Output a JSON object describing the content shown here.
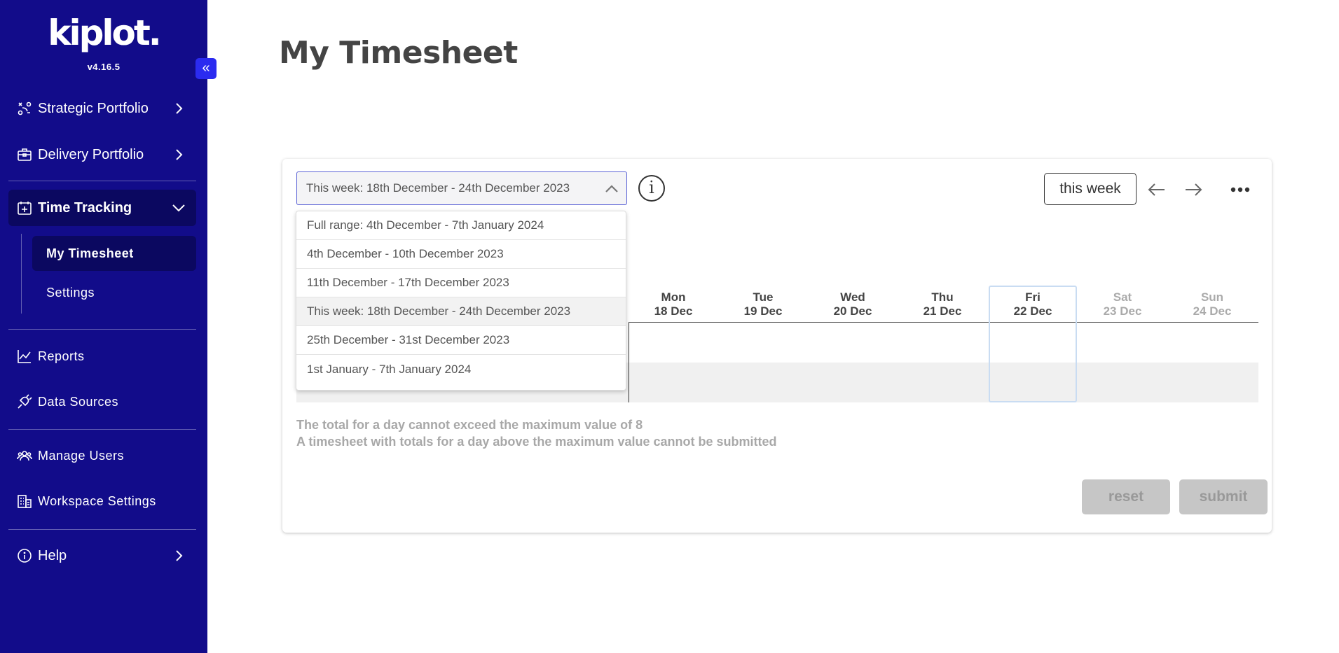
{
  "sidebar": {
    "logo": "kiplot.",
    "version": "v4.16.5",
    "collapse_icon": "double-chevron-left-icon",
    "items": [
      {
        "label": "Strategic Portfolio",
        "icon": "strategy-icon"
      },
      {
        "label": "Delivery Portfolio",
        "icon": "briefcase-icon"
      },
      {
        "label": "Time Tracking",
        "icon": "calendar-plus-icon"
      },
      {
        "label": "Reports",
        "icon": "line-chart-icon"
      },
      {
        "label": "Data Sources",
        "icon": "plug-icon"
      },
      {
        "label": "Manage Users",
        "icon": "users-icon"
      },
      {
        "label": "Workspace Settings",
        "icon": "building-icon"
      },
      {
        "label": "Help",
        "icon": "info-icon"
      }
    ],
    "sub_items": [
      {
        "label": "My Timesheet"
      },
      {
        "label": "Settings"
      }
    ]
  },
  "page": {
    "title": "My Timesheet"
  },
  "toolbar": {
    "week_select_value": "This week: 18th December - 24th December 2023",
    "this_week_label": "this week"
  },
  "dropdown": {
    "options": [
      "Full range: 4th December - 7th January 2024",
      "4th December - 10th December 2023",
      "11th December - 17th December 2023",
      "This week: 18th December - 24th December 2023",
      "25th December - 31st December 2023",
      "1st January - 7th January 2024"
    ],
    "selected": "This week: 18th December - 24th December 2023"
  },
  "days": [
    {
      "name": "Mon",
      "date": "18 Dec"
    },
    {
      "name": "Tue",
      "date": "19 Dec"
    },
    {
      "name": "Wed",
      "date": "20 Dec"
    },
    {
      "name": "Thu",
      "date": "21 Dec"
    },
    {
      "name": "Fri",
      "date": "22 Dec"
    },
    {
      "name": "Sat",
      "date": "23 Dec"
    },
    {
      "name": "Sun",
      "date": "24 Dec"
    }
  ],
  "notes": [
    "The total for a day cannot exceed the maximum value of 8",
    "A timesheet with totals for a day above the maximum value cannot be submitted"
  ],
  "actions": {
    "reset_label": "reset",
    "submit_label": "submit"
  },
  "colors": {
    "sidebar_bg": "#120c8a",
    "active_bg": "#0b0860",
    "accent": "#2b2bf0"
  }
}
